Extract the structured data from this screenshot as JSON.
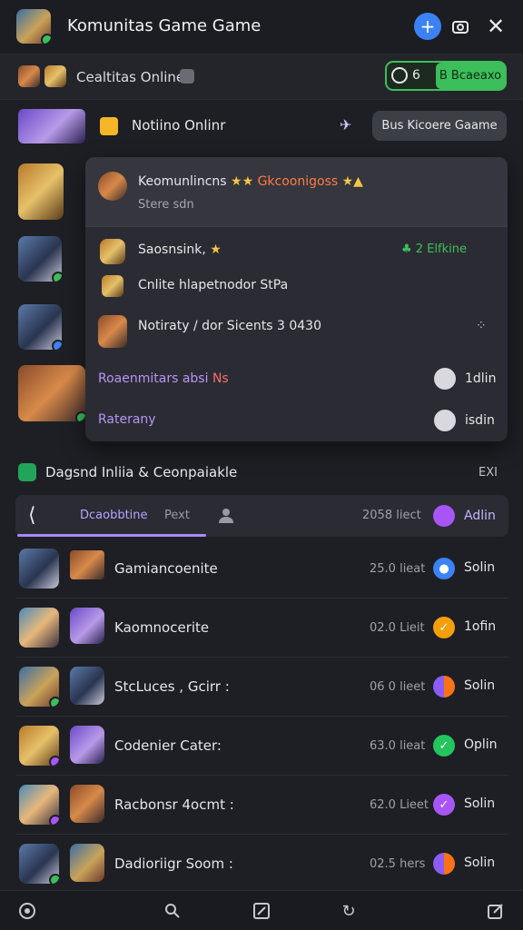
{
  "header": {
    "title": "Komunitas Game Game",
    "add_icon": "plus-icon",
    "camera_icon": "camera-icon",
    "close_icon": "close-icon"
  },
  "online_bar": {
    "label": "Cealtitas Online",
    "count": "6",
    "status_label": "B Bcaeaxo"
  },
  "notifications": {
    "label": "Notiino Onlinr",
    "join_button": "Bus Kicoere Gaame"
  },
  "panel": {
    "head_title": "Keomunlincns",
    "head_title_accent": "Gkcoonigoss",
    "head_sub": "Stere sdn",
    "items": [
      {
        "label": "Saosnsink,",
        "right": "2 Elfkine"
      },
      {
        "label": "Cnlite hlapetnodor StPa",
        "right": ""
      },
      {
        "label": "Notiraty / dor Sicents 3 0430",
        "right": ""
      },
      {
        "label": "Roaenmitars absi",
        "label_extra": "Ns",
        "right": "1dlin"
      },
      {
        "label": "Raterany",
        "right": "isdin"
      }
    ]
  },
  "section": {
    "title": "Dagsnd Inliia & Ceonpaiakle",
    "right_label": "EXI"
  },
  "tabs": {
    "active": "Dcaobbtine",
    "second": "Pext",
    "count_label": "2058 liect",
    "count_action": "Adlin"
  },
  "list": [
    {
      "name": "Gamiancoenite",
      "time": "25.0 lieat",
      "status": "Solin",
      "status_color": "#3b82f6",
      "status_icon": "drop"
    },
    {
      "name": "Kaomnocerite",
      "time": "02.0 Lieit",
      "status": "1ofin",
      "status_color": "#f59e0b",
      "status_icon": "check"
    },
    {
      "name": "StcLuces , Gcirr :",
      "time": "06 0 lieet",
      "status": "Solin",
      "status_color": "#f97316",
      "status_icon": "pie"
    },
    {
      "name": "Codenier Cater:",
      "time": "63.0 lieat",
      "status": "Oplin",
      "status_color": "#22c55e",
      "status_icon": "check"
    },
    {
      "name": "Racbonsr 4ocmt :",
      "time": "62.0 Lieet",
      "status": "Solin",
      "status_color": "#a855f7",
      "status_icon": "check"
    },
    {
      "name": "Dadioriigr Soom :",
      "time": "02.5 hers",
      "status": "Solin",
      "status_color": "#f97316",
      "status_icon": "pie"
    }
  ],
  "bottom_nav": [
    "home-icon",
    "search-icon",
    "edit-icon",
    "refresh-icon",
    "compose-icon"
  ],
  "colors": {
    "accent": "#a78bfa",
    "online": "#3cbf5a",
    "bg": "#1e1f24"
  }
}
